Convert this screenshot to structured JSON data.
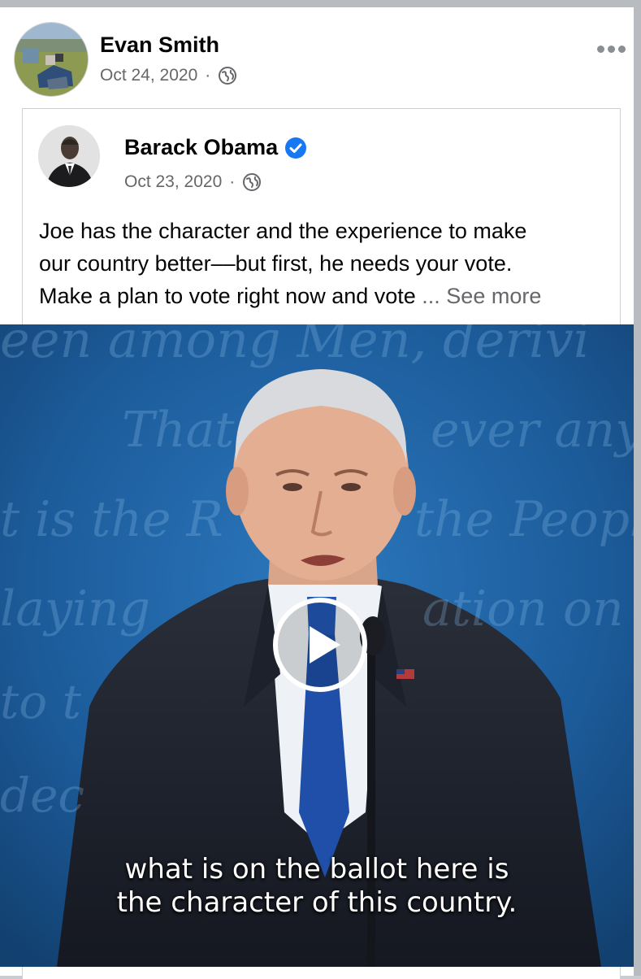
{
  "sharer": {
    "name": "Evan Smith",
    "date": "Oct 24, 2020",
    "separator": "·",
    "privacy_icon": "globe-icon",
    "more_icon": "more-options-icon"
  },
  "shared_post": {
    "author": "Barack Obama",
    "verified_icon": "verified-badge-icon",
    "date": "Oct 23, 2020",
    "separator": "·",
    "privacy_icon": "globe-icon",
    "text_lines": [
      "Joe has the character and the experience to make",
      "our country better––but first, he needs your vote.",
      "Make a plan to vote right now and vote "
    ],
    "see_more": "... See more"
  },
  "video": {
    "play_icon": "play-icon",
    "caption_lines": [
      "what is on the ballot here is",
      "the character of this country."
    ]
  },
  "colors": {
    "verified_blue": "#1877f2",
    "meta_gray": "#65676b",
    "video_background": "#1d5c9d"
  }
}
